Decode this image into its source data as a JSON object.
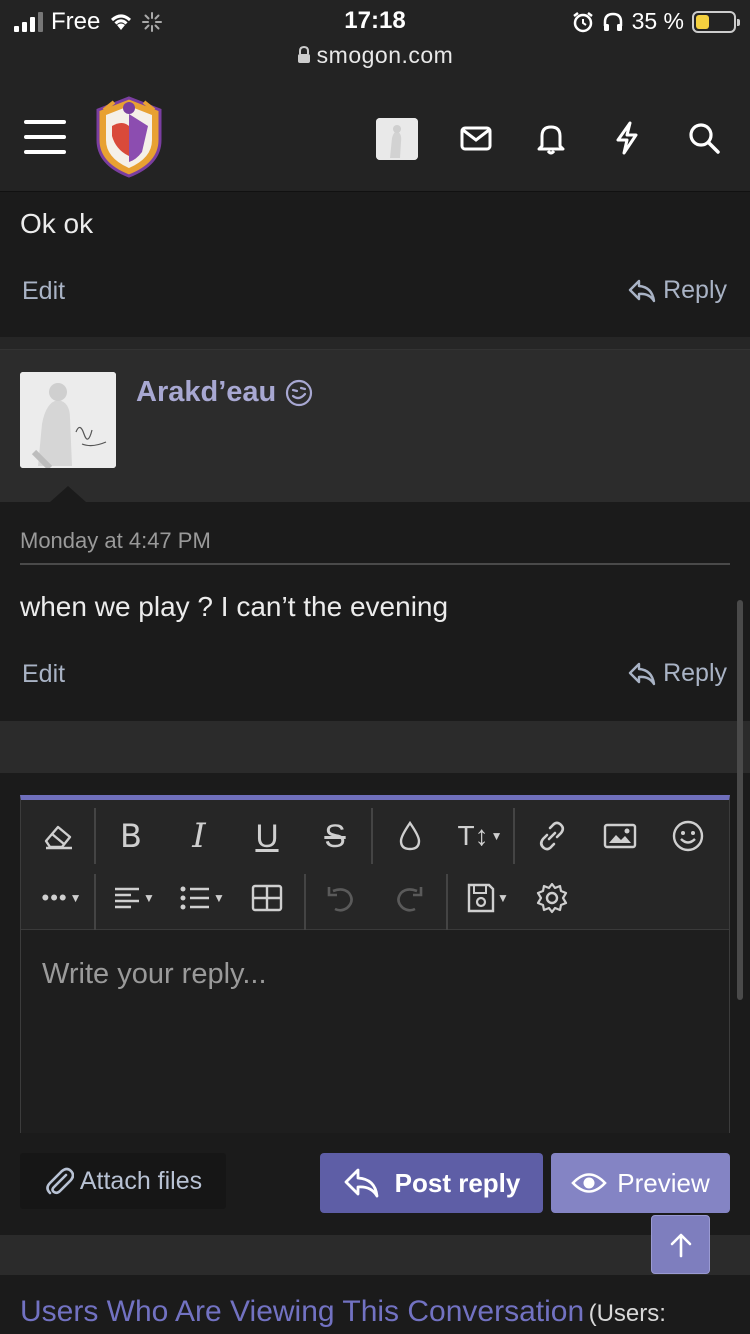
{
  "status_bar": {
    "carrier": "Free",
    "time": "17:18",
    "url": "smogon.com",
    "battery": "35 %",
    "battery_level": 0.35
  },
  "nav": {
    "icons": [
      "menu-icon",
      "site-logo",
      "user-avatar",
      "mail-icon",
      "bell-icon",
      "lightning-icon",
      "search-icon"
    ]
  },
  "previous_post": {
    "text": "Ok ok",
    "edit_label": "Edit",
    "reply_label": "Reply"
  },
  "post": {
    "username": "Arakd’eau",
    "date": "Monday at 4:47 PM",
    "text": "when we play ? I can’t the evening",
    "edit_label": "Edit",
    "reply_label": "Reply"
  },
  "editor": {
    "placeholder": "Write your reply...",
    "toolbar_row1": [
      "eraser-icon",
      "bold-icon",
      "italic-icon",
      "underline-icon",
      "strikethrough-icon",
      "color-drop-icon",
      "text-size-icon",
      "link-icon",
      "image-icon",
      "smiley-icon"
    ],
    "toolbar_row2": [
      "more-icon",
      "align-icon",
      "list-icon",
      "table-icon",
      "undo-icon",
      "redo-icon",
      "save-draft-icon",
      "settings-icon"
    ]
  },
  "buttons": {
    "attach": "Attach files",
    "post_reply": "Post reply",
    "preview": "Preview"
  },
  "viewers": {
    "title": "Users Who Are Viewing This Conversation",
    "subtitle": "(Users:"
  },
  "colors": {
    "accent": "#6f6fbc",
    "post_button": "#5e5ea6",
    "preview_button": "#8484c4",
    "username": "#a8a8d2",
    "link_title": "#7272c2"
  }
}
